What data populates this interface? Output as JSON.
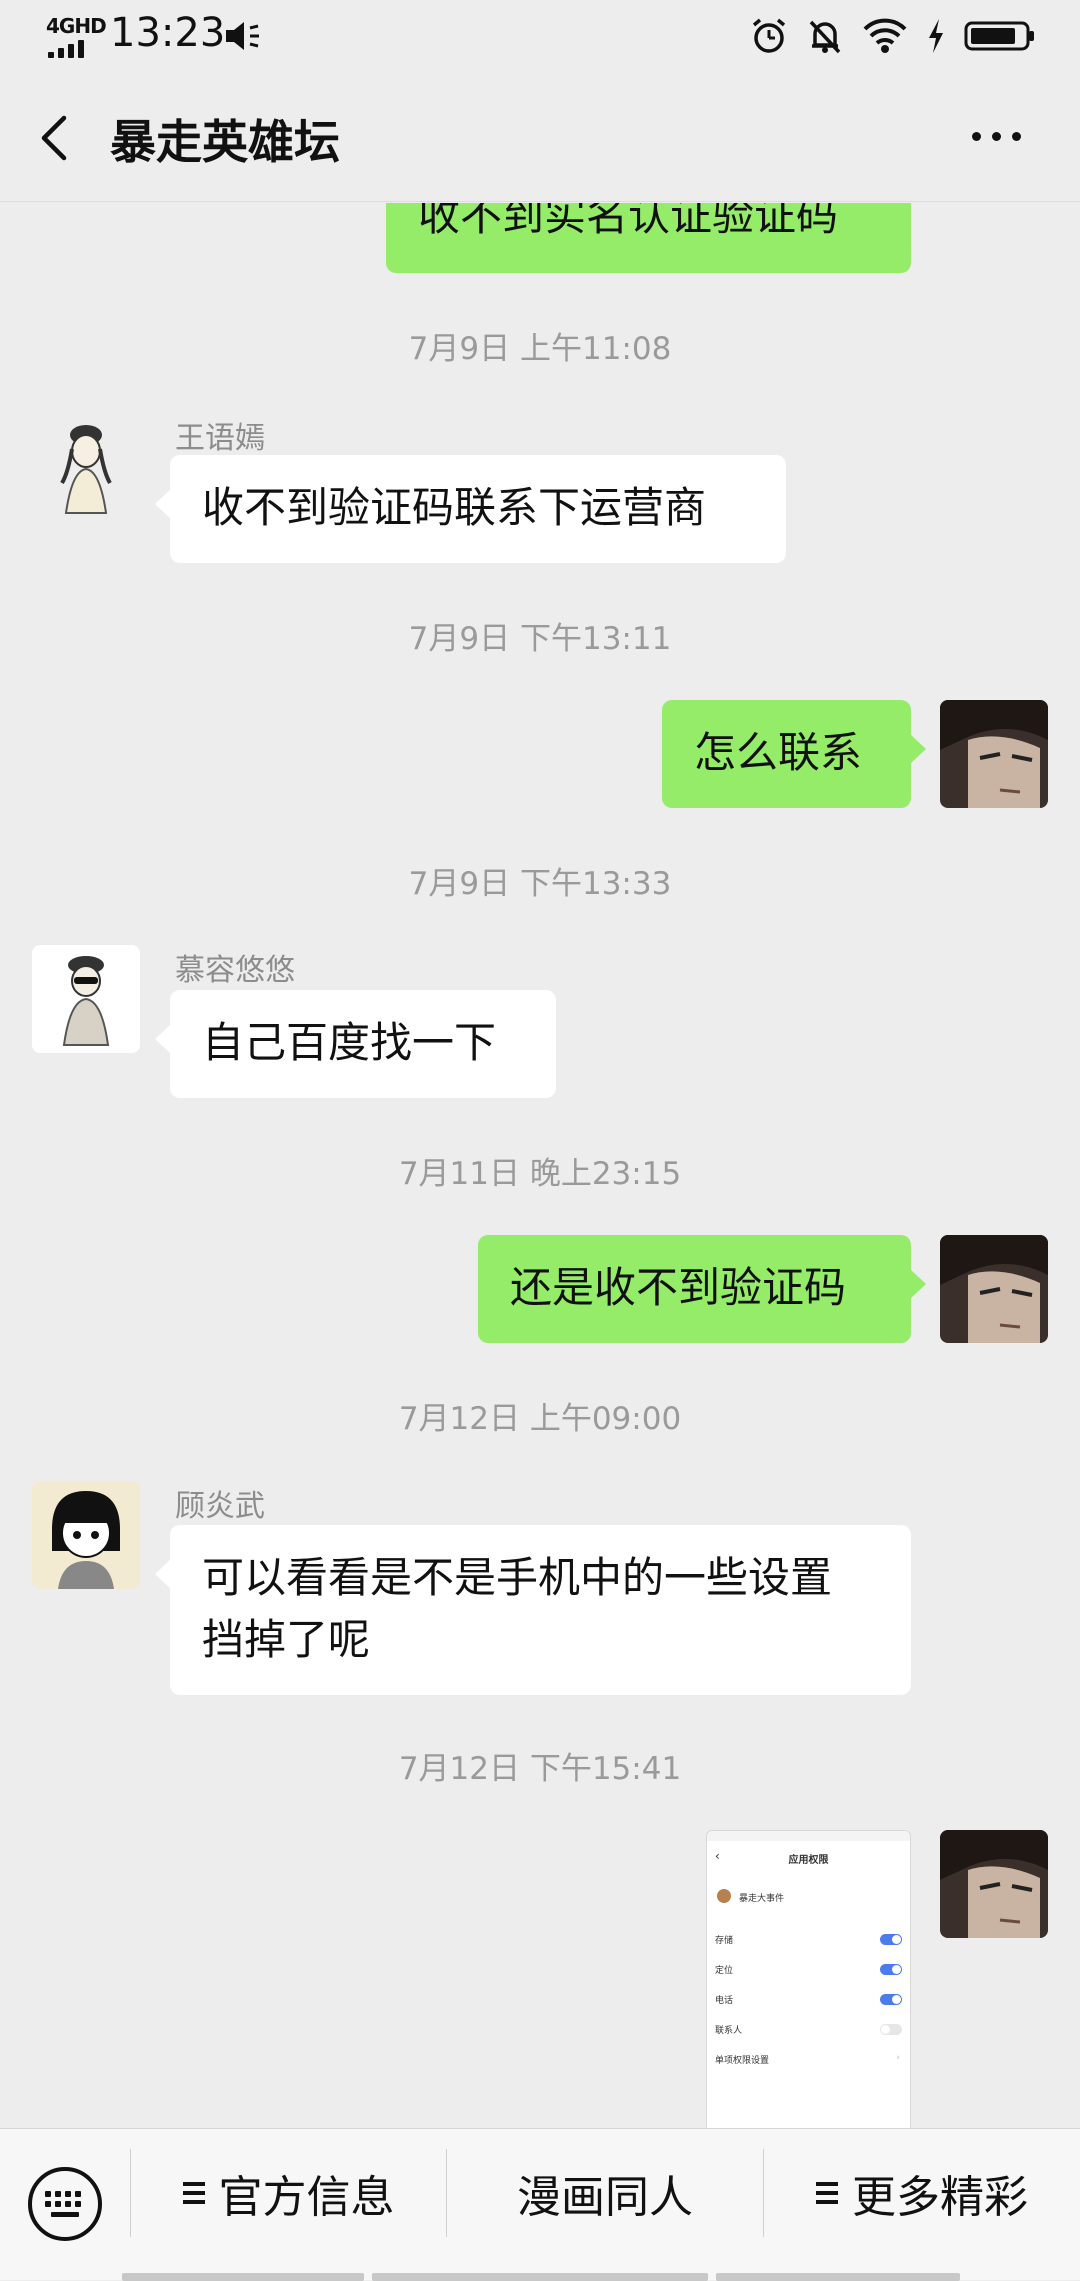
{
  "status_bar": {
    "network": "4GHD",
    "time": "13:23"
  },
  "header": {
    "title": "暴走英雄坛"
  },
  "messages": {
    "m0": {
      "text": "收不到实名认证验证码"
    },
    "ts1": "7月9日 上午11:08",
    "m1": {
      "sender": "王语嫣",
      "text": "收不到验证码联系下运营商"
    },
    "ts2": "7月9日 下午13:11",
    "m2": {
      "text": "怎么联系"
    },
    "ts3": "7月9日 下午13:33",
    "m3": {
      "sender": "慕容悠悠",
      "text": "自己百度找一下"
    },
    "ts4": "7月11日 晚上23:15",
    "m4": {
      "text": "还是收不到验证码"
    },
    "ts5": "7月12日 上午09:00",
    "m5": {
      "sender": "顾炎武",
      "line1": "可以看看是不是手机中的一些设置",
      "line2": "挡掉了呢"
    },
    "ts6": "7月12日 下午15:41",
    "m6_image": {
      "title": "应用权限",
      "app_name": "暴走大事件",
      "rows": [
        {
          "label": "存储",
          "on": true
        },
        {
          "label": "定位",
          "on": true
        },
        {
          "label": "电话",
          "on": true
        },
        {
          "label": "联系人",
          "on": false
        },
        {
          "label": "单项权限设置",
          "on": null
        }
      ]
    }
  },
  "bottom_bar": {
    "menu1": "官方信息",
    "menu2": "漫画同人",
    "menu3": "更多精彩"
  },
  "colors": {
    "background": "#ededed",
    "bubble_self": "#95ec69",
    "bubble_other": "#ffffff",
    "toggle_on": "#4b7bec"
  }
}
